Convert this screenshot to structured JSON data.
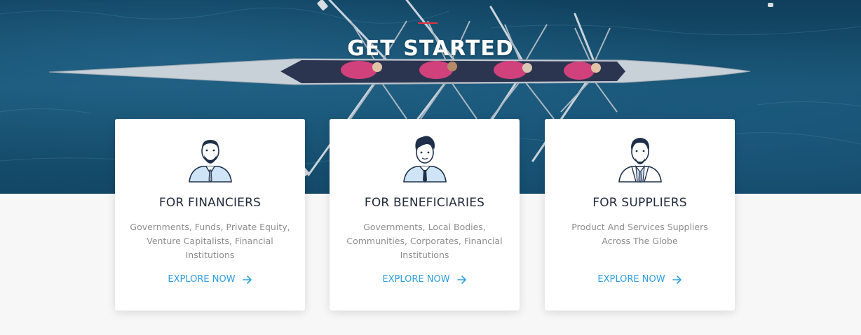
{
  "hero": {
    "title": "GET STARTED"
  },
  "cards": [
    {
      "title": "FOR FINANCIERS",
      "description": "Governments, Funds, Private Equity, Venture Capitalists, Financial Institutions",
      "cta": "EXPLORE NOW",
      "avatar": "financier-avatar-icon"
    },
    {
      "title": "FOR BENEFICIARIES",
      "description": "Governments, Local Bodies, Communities, Corporates, Financial Institutions",
      "cta": "EXPLORE NOW",
      "avatar": "beneficiary-avatar-icon"
    },
    {
      "title": "FOR SUPPLIERS",
      "description": "Product And Services Suppliers Across The Globe",
      "cta": "EXPLORE NOW",
      "avatar": "supplier-avatar-icon"
    }
  ],
  "colors": {
    "accent": "#e0343f",
    "link": "#2f9fe0",
    "heading": "#222b3c",
    "body_text": "#8d8d8d"
  },
  "icons": {
    "cta_arrow": "arrow-right-icon"
  }
}
